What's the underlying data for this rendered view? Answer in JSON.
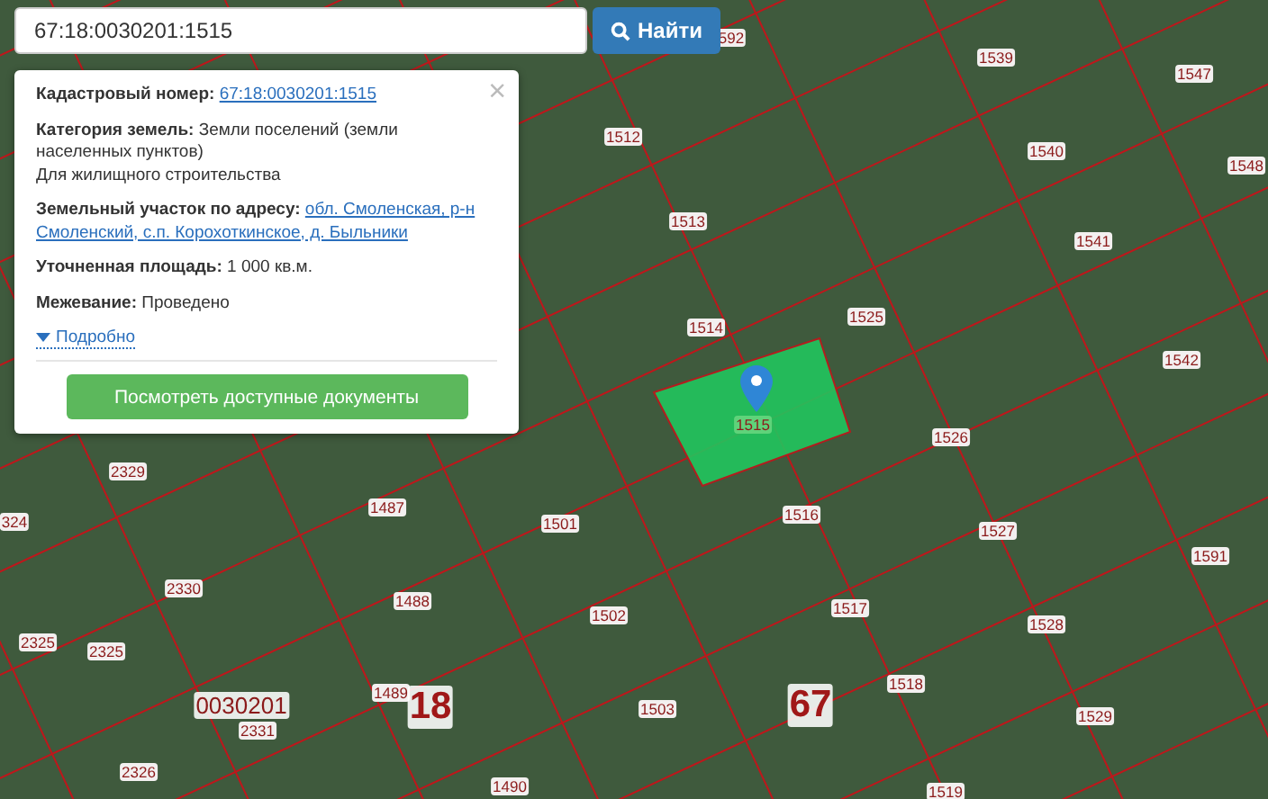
{
  "search": {
    "value": "67:18:0030201:1515",
    "button": "Найти"
  },
  "popup": {
    "fields": [
      {
        "kind": "link",
        "label": "Кадастровый номер:",
        "value": "67:18:0030201:1515"
      },
      {
        "kind": "text",
        "label": "Категория земель:",
        "value": "Земли поселений (земли населенных пунктов)",
        "note": "Для жилищного строительства"
      },
      {
        "kind": "link_lines",
        "label": "Земельный участок по адресу:",
        "lines": [
          "обл. Смоленская, р-н",
          "Смоленский, с.п. Корохоткинское, д. Быльники"
        ]
      },
      {
        "kind": "text",
        "label": "Уточненная площадь:",
        "value": "1 000 кв.м."
      },
      {
        "kind": "text",
        "label": "Межевание:",
        "value": "Проведено"
      }
    ],
    "details_link": "Подробно",
    "close": "×",
    "button": "Посмотреть доступные документы"
  },
  "map": {
    "labels": [
      {
        "kind": "parcel",
        "text": "592"
      },
      {
        "kind": "parcel",
        "text": "1539"
      },
      {
        "kind": "parcel",
        "text": "1547"
      },
      {
        "kind": "parcel",
        "text": "1512"
      },
      {
        "kind": "parcel",
        "text": "1540"
      },
      {
        "kind": "parcel",
        "text": "1548"
      },
      {
        "kind": "parcel",
        "text": "1513"
      },
      {
        "kind": "parcel",
        "text": "1541"
      },
      {
        "kind": "parcel",
        "text": "1514"
      },
      {
        "kind": "parcel",
        "text": "1525"
      },
      {
        "kind": "parcel",
        "text": "1542"
      },
      {
        "kind": "selected",
        "text": "1515"
      },
      {
        "kind": "parcel",
        "text": "1526"
      },
      {
        "kind": "parcel",
        "text": "2329"
      },
      {
        "kind": "parcel",
        "text": "1487"
      },
      {
        "kind": "parcel",
        "text": "324"
      },
      {
        "kind": "parcel",
        "text": "1516"
      },
      {
        "kind": "parcel",
        "text": "1501"
      },
      {
        "kind": "parcel",
        "text": "1527"
      },
      {
        "kind": "parcel",
        "text": "1591"
      },
      {
        "kind": "parcel",
        "text": "2330"
      },
      {
        "kind": "parcel",
        "text": "1488"
      },
      {
        "kind": "parcel",
        "text": "1502"
      },
      {
        "kind": "parcel",
        "text": "1517"
      },
      {
        "kind": "parcel",
        "text": "1528"
      },
      {
        "kind": "parcel",
        "text": "2325"
      },
      {
        "kind": "parcel",
        "text": "2325"
      },
      {
        "kind": "quarter",
        "text": "0030201"
      },
      {
        "kind": "parcel",
        "text": "1489"
      },
      {
        "kind": "district",
        "text": "18"
      },
      {
        "kind": "parcel",
        "text": "1518"
      },
      {
        "kind": "parcel",
        "text": "1503"
      },
      {
        "kind": "region",
        "text": "67"
      },
      {
        "kind": "parcel",
        "text": "1529"
      },
      {
        "kind": "parcel",
        "text": "2331"
      },
      {
        "kind": "parcel",
        "text": "2326"
      },
      {
        "kind": "parcel",
        "text": "1490"
      },
      {
        "kind": "parcel",
        "text": "1519"
      }
    ]
  }
}
